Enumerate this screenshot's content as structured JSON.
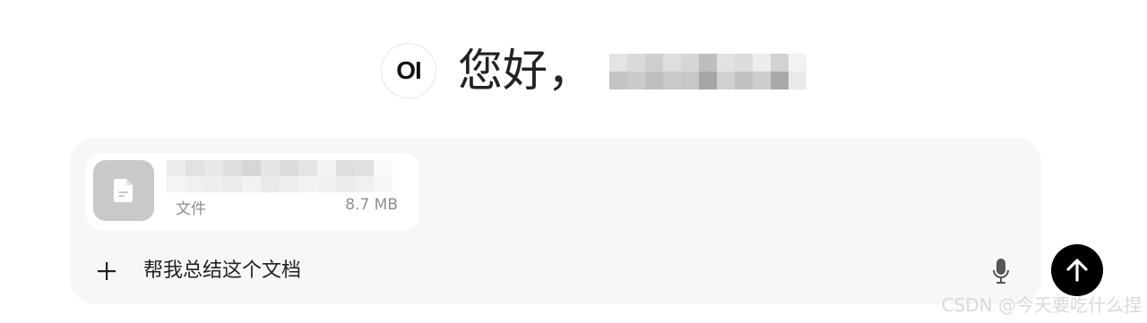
{
  "greeting": {
    "logo_text": "OI",
    "text": "您好，"
  },
  "attachment": {
    "type_label": "文件",
    "size": "8.7 MB",
    "icon": "document-icon"
  },
  "composer": {
    "input_value": "帮我总结这个文档",
    "plus_label": "+",
    "mic_icon": "microphone-icon",
    "send_icon": "arrow-up-icon"
  },
  "watermark": "CSDN @今天要吃什么捏",
  "colors": {
    "send_button": "#000000",
    "composer_bg": "#f7f7f7",
    "file_icon_bg": "#c9c9c9"
  }
}
